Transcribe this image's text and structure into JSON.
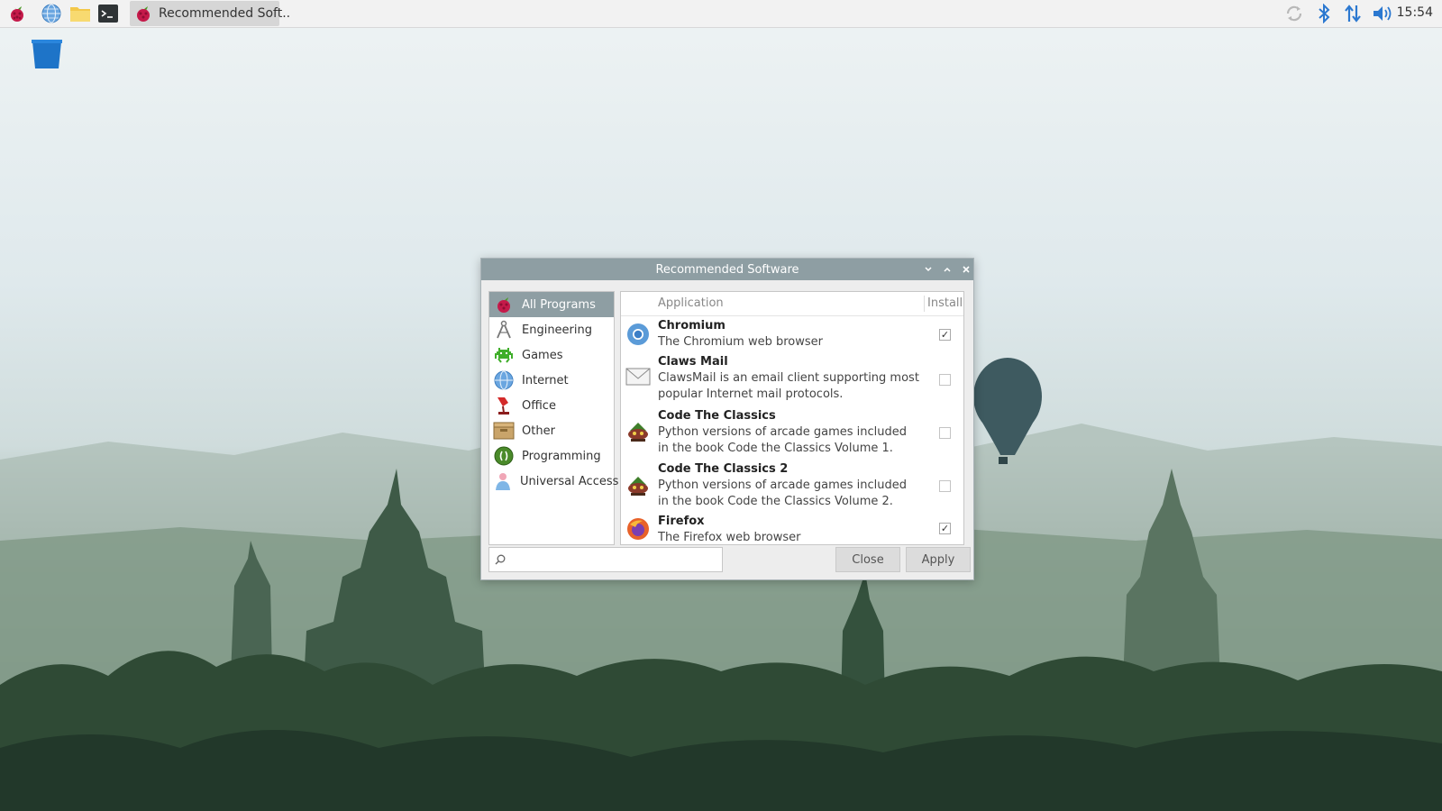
{
  "panel": {
    "launchers": [
      "raspberry-menu",
      "web-browser",
      "file-manager",
      "terminal"
    ],
    "task": {
      "label": "Recommended Soft.."
    },
    "tray": [
      "update-icon",
      "bluetooth-icon",
      "network-icon",
      "volume-icon"
    ],
    "clock": "15:54"
  },
  "window": {
    "title": "Recommended Software",
    "categories": [
      {
        "label": "All Programs",
        "icon": "raspberry-icon",
        "selected": true
      },
      {
        "label": "Engineering",
        "icon": "compass-icon"
      },
      {
        "label": "Games",
        "icon": "invader-icon"
      },
      {
        "label": "Internet",
        "icon": "globe-icon"
      },
      {
        "label": "Office",
        "icon": "office-icon"
      },
      {
        "label": "Other",
        "icon": "box-icon"
      },
      {
        "label": "Programming",
        "icon": "programming-icon"
      },
      {
        "label": "Universal Access",
        "icon": "person-icon"
      }
    ],
    "columns": {
      "application": "Application",
      "install": "Install"
    },
    "apps": [
      {
        "name": "Chromium",
        "desc": "The Chromium web browser",
        "checked": true,
        "icon": "chromium-icon"
      },
      {
        "name": "Claws Mail",
        "desc": "ClawsMail is an email client supporting most popular Internet mail protocols.",
        "checked": false,
        "icon": "mail-icon"
      },
      {
        "name": "Code The Classics",
        "desc": "Python versions of arcade games included in the book Code the Classics Volume 1.",
        "checked": false,
        "icon": "code-classics-icon"
      },
      {
        "name": "Code The Classics 2",
        "desc": "Python versions of arcade games included in the book Code the Classics Volume 2.",
        "checked": false,
        "icon": "code-classics-icon"
      },
      {
        "name": "Firefox",
        "desc": "The Firefox web browser",
        "checked": true,
        "icon": "firefox-icon"
      }
    ],
    "search": {
      "value": "",
      "placeholder": ""
    },
    "buttons": {
      "close": "Close",
      "apply": "Apply"
    }
  },
  "colors": {
    "selection": "#8e9ea3",
    "titlebar": "#8e9ea3",
    "panel": "#f2f2f2"
  }
}
